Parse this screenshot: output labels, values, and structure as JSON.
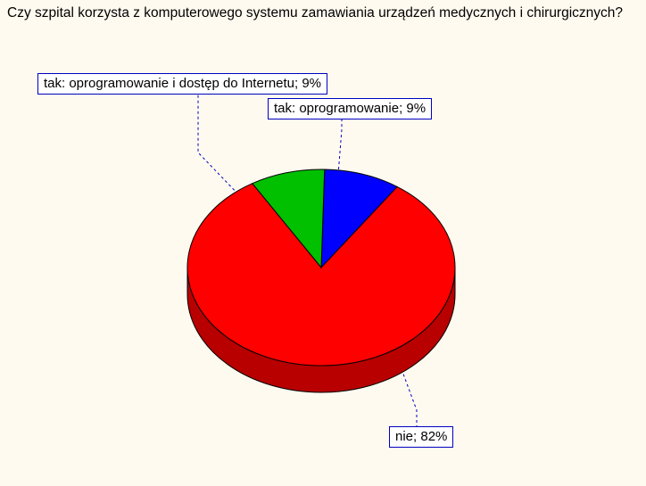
{
  "title": "Czy szpital korzysta z komputerowego systemu zamawiania urządzeń medycznych i chirurgicznych?",
  "labels": {
    "green": "tak: oprogramowanie i dostęp do Internetu; 9%",
    "blue": "tak: oprogramowanie; 9%",
    "red": "nie; 82%"
  },
  "chart_data": {
    "type": "pie",
    "title": "Czy szpital korzysta z komputerowego systemu zamawiania urządzeń medycznych i chirurgicznych?",
    "series": [
      {
        "name": "nie",
        "value": 82,
        "color": "#FF0000"
      },
      {
        "name": "tak: oprogramowanie",
        "value": 9,
        "color": "#0000FF"
      },
      {
        "name": "tak: oprogramowanie i dostęp do Internetu",
        "value": 9,
        "color": "#00C000"
      }
    ]
  }
}
